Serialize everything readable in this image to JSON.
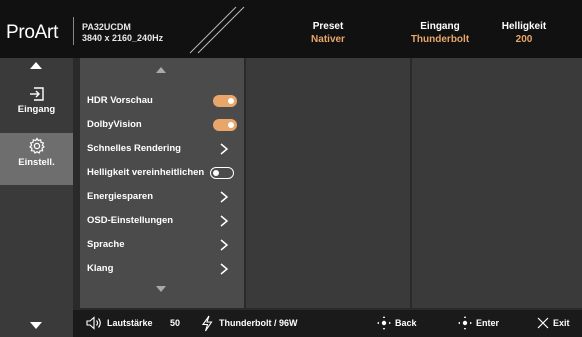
{
  "header": {
    "logo": "ProArt",
    "model_name": "PA32UCDM",
    "resolution": "3840 x 2160_240Hz",
    "preset": {
      "label": "Preset",
      "value": "Nativer"
    },
    "input": {
      "label": "Eingang",
      "value": "Thunderbolt"
    },
    "brightness": {
      "label": "Helligkeit",
      "value": "200"
    }
  },
  "sidebar": {
    "items": [
      {
        "label": "Eingang",
        "icon": "input-icon",
        "active": false
      },
      {
        "label": "Einstell.",
        "icon": "gear-icon",
        "active": true
      }
    ]
  },
  "menu": {
    "items": [
      {
        "label": "HDR Vorschau",
        "control": "toggle-on"
      },
      {
        "label": "DolbyVision",
        "control": "toggle-on"
      },
      {
        "label": "Schnelles Rendering",
        "control": "chevron"
      },
      {
        "label": "Helligkeit vereinheitlichen",
        "control": "toggle-off"
      },
      {
        "label": "Energiesparen",
        "control": "chevron"
      },
      {
        "label": "OSD-Einstellungen",
        "control": "chevron"
      },
      {
        "label": "Sprache",
        "control": "chevron"
      },
      {
        "label": "Klang",
        "control": "chevron"
      }
    ]
  },
  "footer": {
    "volume_label": "Lautstärke",
    "volume_value": "50",
    "power_label": "Thunderbolt / 96W",
    "back_label": "Back",
    "enter_label": "Enter",
    "exit_label": "Exit"
  },
  "colors": {
    "accent": "#e8a66a",
    "header_bg": "#111111",
    "menu_bg": "#4b4b4b"
  }
}
